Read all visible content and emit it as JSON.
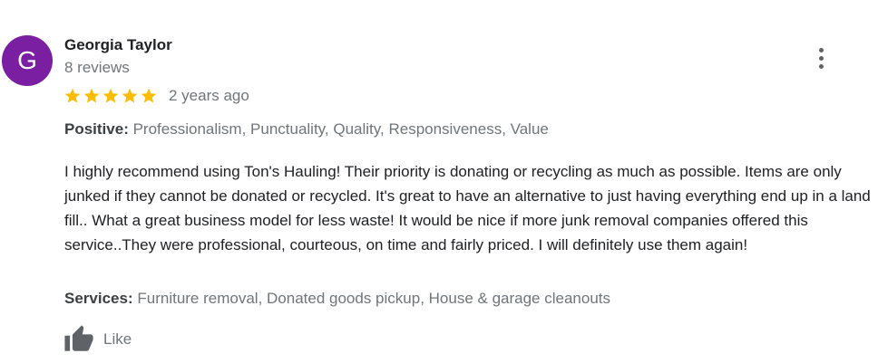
{
  "review": {
    "author_initial": "G",
    "author_name": "Georgia Taylor",
    "author_reviews": "8 reviews",
    "rating": 5,
    "rating_max": 5,
    "time_ago": "2 years ago",
    "positive_label": "Positive:",
    "positive_values": "Professionalism, Punctuality, Quality, Responsiveness, Value",
    "text": "I highly recommend using Ton's Hauling! Their priority is donating or recycling as much as possible. Items are only junked if they cannot be donated or recycled. It's great to have an alternative to just having everything end up in a land fill.. What a great business model for less waste!  It would be nice if more junk removal companies offered this service..They were professional, courteous, on time and fairly priced. I will definitely use them again!",
    "services_label": "Services:",
    "services_values": "Furniture removal, Donated goods pickup, House & garage cleanouts",
    "like_label": "Like"
  },
  "icons": {
    "menu": "more-vertical-icon",
    "star": "star-icon",
    "like": "thumbs-up-icon"
  },
  "colors": {
    "avatar_bg": "#7b1fa2",
    "star": "#fbbc04",
    "secondary_text": "#70757a",
    "icon": "#5f6368"
  }
}
